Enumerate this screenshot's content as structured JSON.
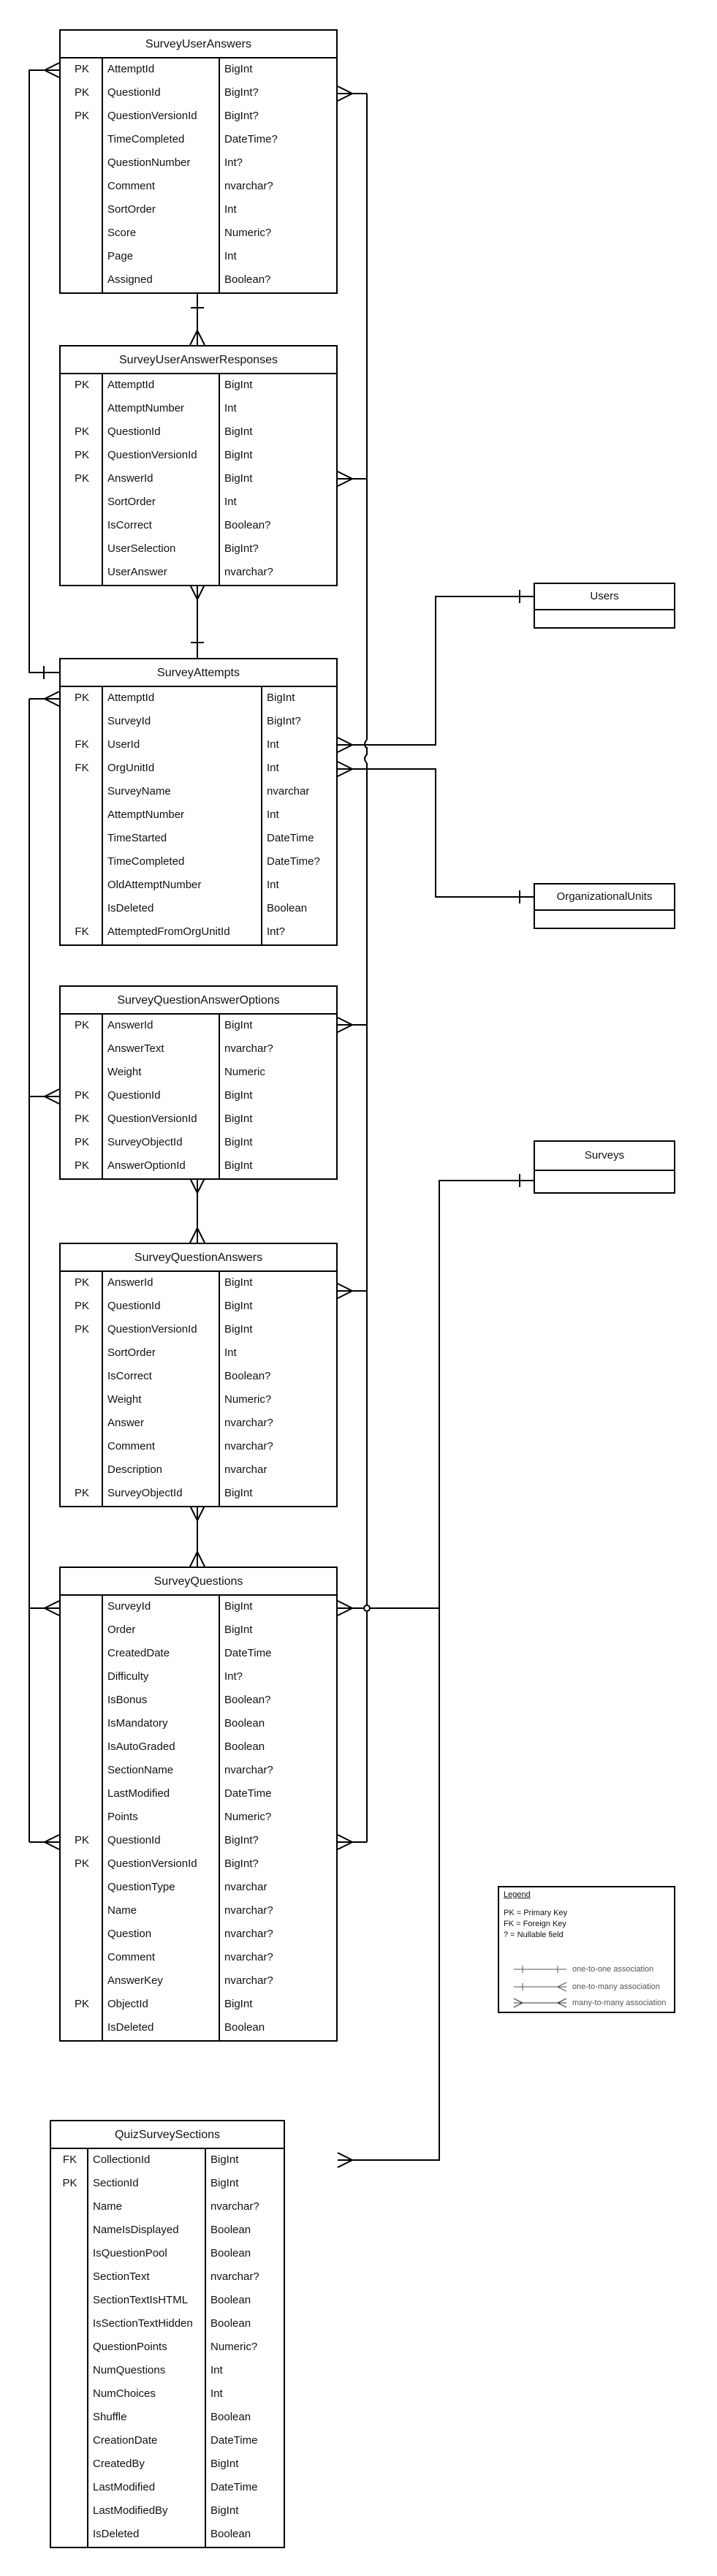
{
  "entities": [
    {
      "name": "SurveyUserAnswers",
      "rows": [
        {
          "key": "PK",
          "name": "AttemptId",
          "type": "BigInt"
        },
        {
          "key": "PK",
          "name": "QuestionId",
          "type": "BigInt?"
        },
        {
          "key": "PK",
          "name": "QuestionVersionId",
          "type": "BigInt?"
        },
        {
          "key": "",
          "name": "TimeCompleted",
          "type": "DateTime?"
        },
        {
          "key": "",
          "name": "QuestionNumber",
          "type": "Int?"
        },
        {
          "key": "",
          "name": "Comment",
          "type": "nvarchar?"
        },
        {
          "key": "",
          "name": "SortOrder",
          "type": "Int"
        },
        {
          "key": "",
          "name": "Score",
          "type": "Numeric?"
        },
        {
          "key": "",
          "name": "Page",
          "type": "Int"
        },
        {
          "key": "",
          "name": "Assigned",
          "type": "Boolean?"
        }
      ]
    },
    {
      "name": "SurveyUserAnswerResponses",
      "rows": [
        {
          "key": "PK",
          "name": "AttemptId",
          "type": "BigInt"
        },
        {
          "key": "",
          "name": "AttemptNumber",
          "type": "Int"
        },
        {
          "key": "PK",
          "name": "QuestionId",
          "type": "BigInt"
        },
        {
          "key": "PK",
          "name": "QuestionVersionId",
          "type": "BigInt"
        },
        {
          "key": "PK",
          "name": "AnswerId",
          "type": "BigInt"
        },
        {
          "key": "",
          "name": "SortOrder",
          "type": "Int"
        },
        {
          "key": "",
          "name": "IsCorrect",
          "type": "Boolean?"
        },
        {
          "key": "",
          "name": "UserSelection",
          "type": "BigInt?"
        },
        {
          "key": "",
          "name": "UserAnswer",
          "type": "nvarchar?"
        }
      ]
    },
    {
      "name": "SurveyAttempts",
      "rows": [
        {
          "key": "PK",
          "name": "AttemptId",
          "type": "BigInt"
        },
        {
          "key": "",
          "name": "SurveyId",
          "type": "BigInt?"
        },
        {
          "key": "FK",
          "name": "UserId",
          "type": "Int"
        },
        {
          "key": "FK",
          "name": "OrgUnitId",
          "type": "Int"
        },
        {
          "key": "",
          "name": "SurveyName",
          "type": "nvarchar"
        },
        {
          "key": "",
          "name": "AttemptNumber",
          "type": "Int"
        },
        {
          "key": "",
          "name": "TimeStarted",
          "type": "DateTime"
        },
        {
          "key": "",
          "name": "TimeCompleted",
          "type": "DateTime?"
        },
        {
          "key": "",
          "name": "OldAttemptNumber",
          "type": "Int"
        },
        {
          "key": "",
          "name": "IsDeleted",
          "type": "Boolean"
        },
        {
          "key": "FK",
          "name": "AttemptedFromOrgUnitId",
          "type": "Int?"
        }
      ]
    },
    {
      "name": "SurveyQuestionAnswerOptions",
      "rows": [
        {
          "key": "PK",
          "name": "AnswerId",
          "type": "BigInt"
        },
        {
          "key": "",
          "name": "AnswerText",
          "type": "nvarchar?"
        },
        {
          "key": "",
          "name": "Weight",
          "type": "Numeric"
        },
        {
          "key": "PK",
          "name": "QuestionId",
          "type": "BigInt"
        },
        {
          "key": "PK",
          "name": "QuestionVersionId",
          "type": "BigInt"
        },
        {
          "key": "PK",
          "name": "SurveyObjectId",
          "type": "BigInt"
        },
        {
          "key": "PK",
          "name": "AnswerOptionId",
          "type": "BigInt"
        }
      ]
    },
    {
      "name": "SurveyQuestionAnswers",
      "rows": [
        {
          "key": "PK",
          "name": "AnswerId",
          "type": "BigInt"
        },
        {
          "key": "PK",
          "name": "QuestionId",
          "type": "BigInt"
        },
        {
          "key": "PK",
          "name": "QuestionVersionId",
          "type": "BigInt"
        },
        {
          "key": "",
          "name": "SortOrder",
          "type": "Int"
        },
        {
          "key": "",
          "name": "IsCorrect",
          "type": "Boolean?"
        },
        {
          "key": "",
          "name": "Weight",
          "type": "Numeric?"
        },
        {
          "key": "",
          "name": "Answer",
          "type": "nvarchar?"
        },
        {
          "key": "",
          "name": "Comment",
          "type": "nvarchar?"
        },
        {
          "key": "",
          "name": "Description",
          "type": "nvarchar"
        },
        {
          "key": "PK",
          "name": "SurveyObjectId",
          "type": "BigInt"
        }
      ]
    },
    {
      "name": "SurveyQuestions",
      "rows": [
        {
          "key": "",
          "name": "SurveyId",
          "type": "BigInt"
        },
        {
          "key": "",
          "name": "Order",
          "type": "BigInt"
        },
        {
          "key": "",
          "name": "CreatedDate",
          "type": "DateTime"
        },
        {
          "key": "",
          "name": "Difficulty",
          "type": "Int?"
        },
        {
          "key": "",
          "name": "IsBonus",
          "type": "Boolean?"
        },
        {
          "key": "",
          "name": "IsMandatory",
          "type": "Boolean"
        },
        {
          "key": "",
          "name": "IsAutoGraded",
          "type": "Boolean"
        },
        {
          "key": "",
          "name": "SectionName",
          "type": "nvarchar?"
        },
        {
          "key": "",
          "name": "LastModified",
          "type": "DateTime"
        },
        {
          "key": "",
          "name": "Points",
          "type": "Numeric?"
        },
        {
          "key": "PK",
          "name": "QuestionId",
          "type": "BigInt?"
        },
        {
          "key": "PK",
          "name": "QuestionVersionId",
          "type": "BigInt?"
        },
        {
          "key": "",
          "name": "QuestionType",
          "type": "nvarchar"
        },
        {
          "key": "",
          "name": "Name",
          "type": "nvarchar?"
        },
        {
          "key": "",
          "name": "Question",
          "type": "nvarchar?"
        },
        {
          "key": "",
          "name": "Comment",
          "type": "nvarchar?"
        },
        {
          "key": "",
          "name": "AnswerKey",
          "type": "nvarchar?"
        },
        {
          "key": "PK",
          "name": "ObjectId",
          "type": "BigInt"
        },
        {
          "key": "",
          "name": "IsDeleted",
          "type": "Boolean"
        }
      ]
    },
    {
      "name": "QuizSurveySections",
      "rows": [
        {
          "key": "FK",
          "name": "CollectionId",
          "type": "BigInt"
        },
        {
          "key": "PK",
          "name": "SectionId",
          "type": "BigInt"
        },
        {
          "key": "",
          "name": "Name",
          "type": "nvarchar?"
        },
        {
          "key": "",
          "name": "NameIsDisplayed",
          "type": "Boolean"
        },
        {
          "key": "",
          "name": "IsQuestionPool",
          "type": "Boolean"
        },
        {
          "key": "",
          "name": "SectionText",
          "type": "nvarchar?"
        },
        {
          "key": "",
          "name": "SectionTextIsHTML",
          "type": "Boolean"
        },
        {
          "key": "",
          "name": "IsSectionTextHidden",
          "type": "Boolean"
        },
        {
          "key": "",
          "name": "QuestionPoints",
          "type": "Numeric?"
        },
        {
          "key": "",
          "name": "NumQuestions",
          "type": "Int"
        },
        {
          "key": "",
          "name": "NumChoices",
          "type": "Int"
        },
        {
          "key": "",
          "name": "Shuffle",
          "type": "Boolean"
        },
        {
          "key": "",
          "name": "CreationDate",
          "type": "DateTime"
        },
        {
          "key": "",
          "name": "CreatedBy",
          "type": "BigInt"
        },
        {
          "key": "",
          "name": "LastModified",
          "type": "DateTime"
        },
        {
          "key": "",
          "name": "LastModifiedBy",
          "type": "BigInt"
        },
        {
          "key": "",
          "name": "IsDeleted",
          "type": "Boolean"
        }
      ]
    }
  ],
  "stubs": [
    {
      "name": "Users"
    },
    {
      "name": "OrganizationalUnits"
    },
    {
      "name": "Surveys"
    }
  ],
  "legend": {
    "title": "Legend",
    "lines": [
      "PK = Primary Key",
      "FK = Foreign Key",
      "? = Nullable field"
    ],
    "associations": [
      {
        "kind": "one-to-one",
        "label": "one-to-one association"
      },
      {
        "kind": "one-to-many",
        "label": "one-to-many association"
      },
      {
        "kind": "many-to-many",
        "label": "many-to-many association"
      }
    ]
  },
  "relationships": [
    {
      "from": "SurveyUserAnswers",
      "to": "SurveyAttempts",
      "type": "many-to-one"
    },
    {
      "from": "SurveyUserAnswers",
      "to": "SurveyUserAnswerResponses",
      "type": "one-to-many"
    },
    {
      "from": "SurveyUserAnswerResponses",
      "to": "SurveyAttempts",
      "type": "many-to-one"
    },
    {
      "from": "SurveyAttempts",
      "to": "Users",
      "type": "many-to-one"
    },
    {
      "from": "SurveyAttempts",
      "to": "OrganizationalUnits",
      "type": "many-to-one"
    },
    {
      "from": "SurveyQuestionAnswerOptions",
      "to": "SurveyQuestionAnswers",
      "type": "many-to-many"
    },
    {
      "from": "SurveyQuestionAnswers",
      "to": "SurveyQuestions",
      "type": "many-to-many"
    },
    {
      "from": "SurveyQuestions",
      "to": "Surveys",
      "type": "many-to-one"
    },
    {
      "from": "QuizSurveySections",
      "to": "Surveys",
      "type": "many-to-one"
    }
  ]
}
